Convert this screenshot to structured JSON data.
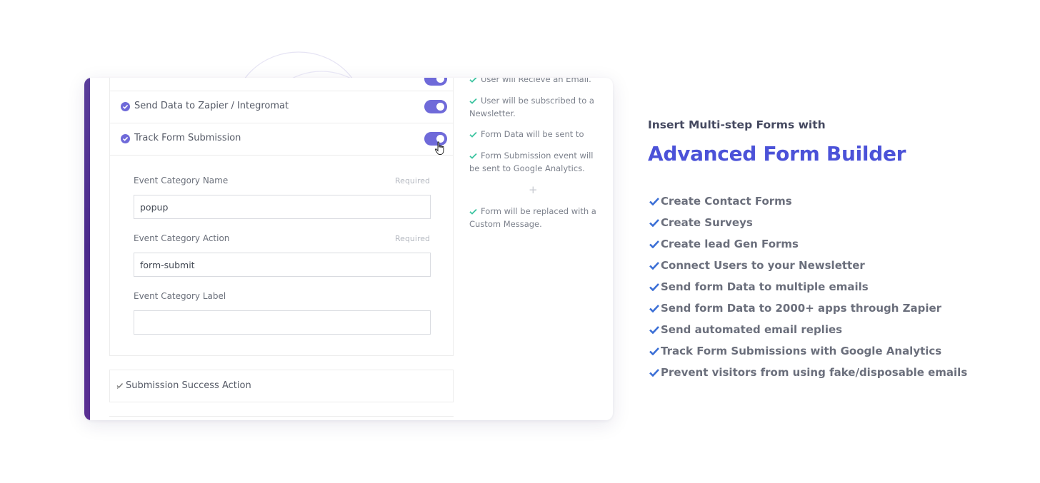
{
  "form": {
    "rows": [
      {
        "label": "Send Data to Zapier / Integromat"
      },
      {
        "label": "Track Form Submission"
      }
    ],
    "fields": [
      {
        "label": "Event Category Name",
        "required": "Required",
        "value": "popup"
      },
      {
        "label": "Event Category Action",
        "required": "Required",
        "value": "form-submit"
      },
      {
        "label": "Event Category Label",
        "required": "",
        "value": ""
      }
    ],
    "success_action": "Submission Success Action"
  },
  "flow": {
    "items": [
      "User will Recieve an Email.",
      "User will be subscribed to a Newsletter.",
      "Form Data will be sent to",
      "Form Submission event will be sent to Google Analytics.",
      "Form will be replaced with a Custom Message."
    ],
    "plus": "+"
  },
  "side": {
    "eyebrow": "Insert Multi-step Forms with",
    "headline": "Advanced Form Builder",
    "features": [
      "Create Contact Forms",
      "Create Surveys",
      "Create lead Gen Forms",
      "Connect Users to your Newsletter",
      "Send form Data to multiple emails",
      "Send form Data to 2000+ apps through Zapier",
      "Send automated email replies",
      "Track Form Submissions with Google Analytics",
      "Prevent visitors from using fake/disposable emails"
    ]
  },
  "colors": {
    "accent": "#4b52d8",
    "toggle": "#6f6ad9",
    "flow_check": "#3cc4a0",
    "feature_check": "#3b6fd6",
    "strip": "#4b2a8c"
  }
}
